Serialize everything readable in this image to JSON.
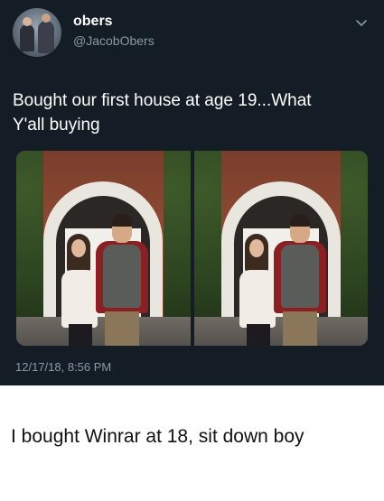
{
  "tweet": {
    "display_name": "obers",
    "handle": "@JacobObers",
    "text_line1": "Bought our first house at age 19...What",
    "text_line2": "Y'all buying",
    "timestamp": "12/17/18, 8:56 PM",
    "menu_icon": "chevron-down-icon",
    "photos": [
      {
        "description_icon": "couple-photo"
      },
      {
        "description_icon": "couple-photo"
      }
    ],
    "colors": {
      "background": "#141d26",
      "secondary_text": "#8899a6",
      "primary_text": "#ffffff"
    }
  },
  "caption": {
    "text": "I bought Winrar at 18, sit down boy"
  }
}
